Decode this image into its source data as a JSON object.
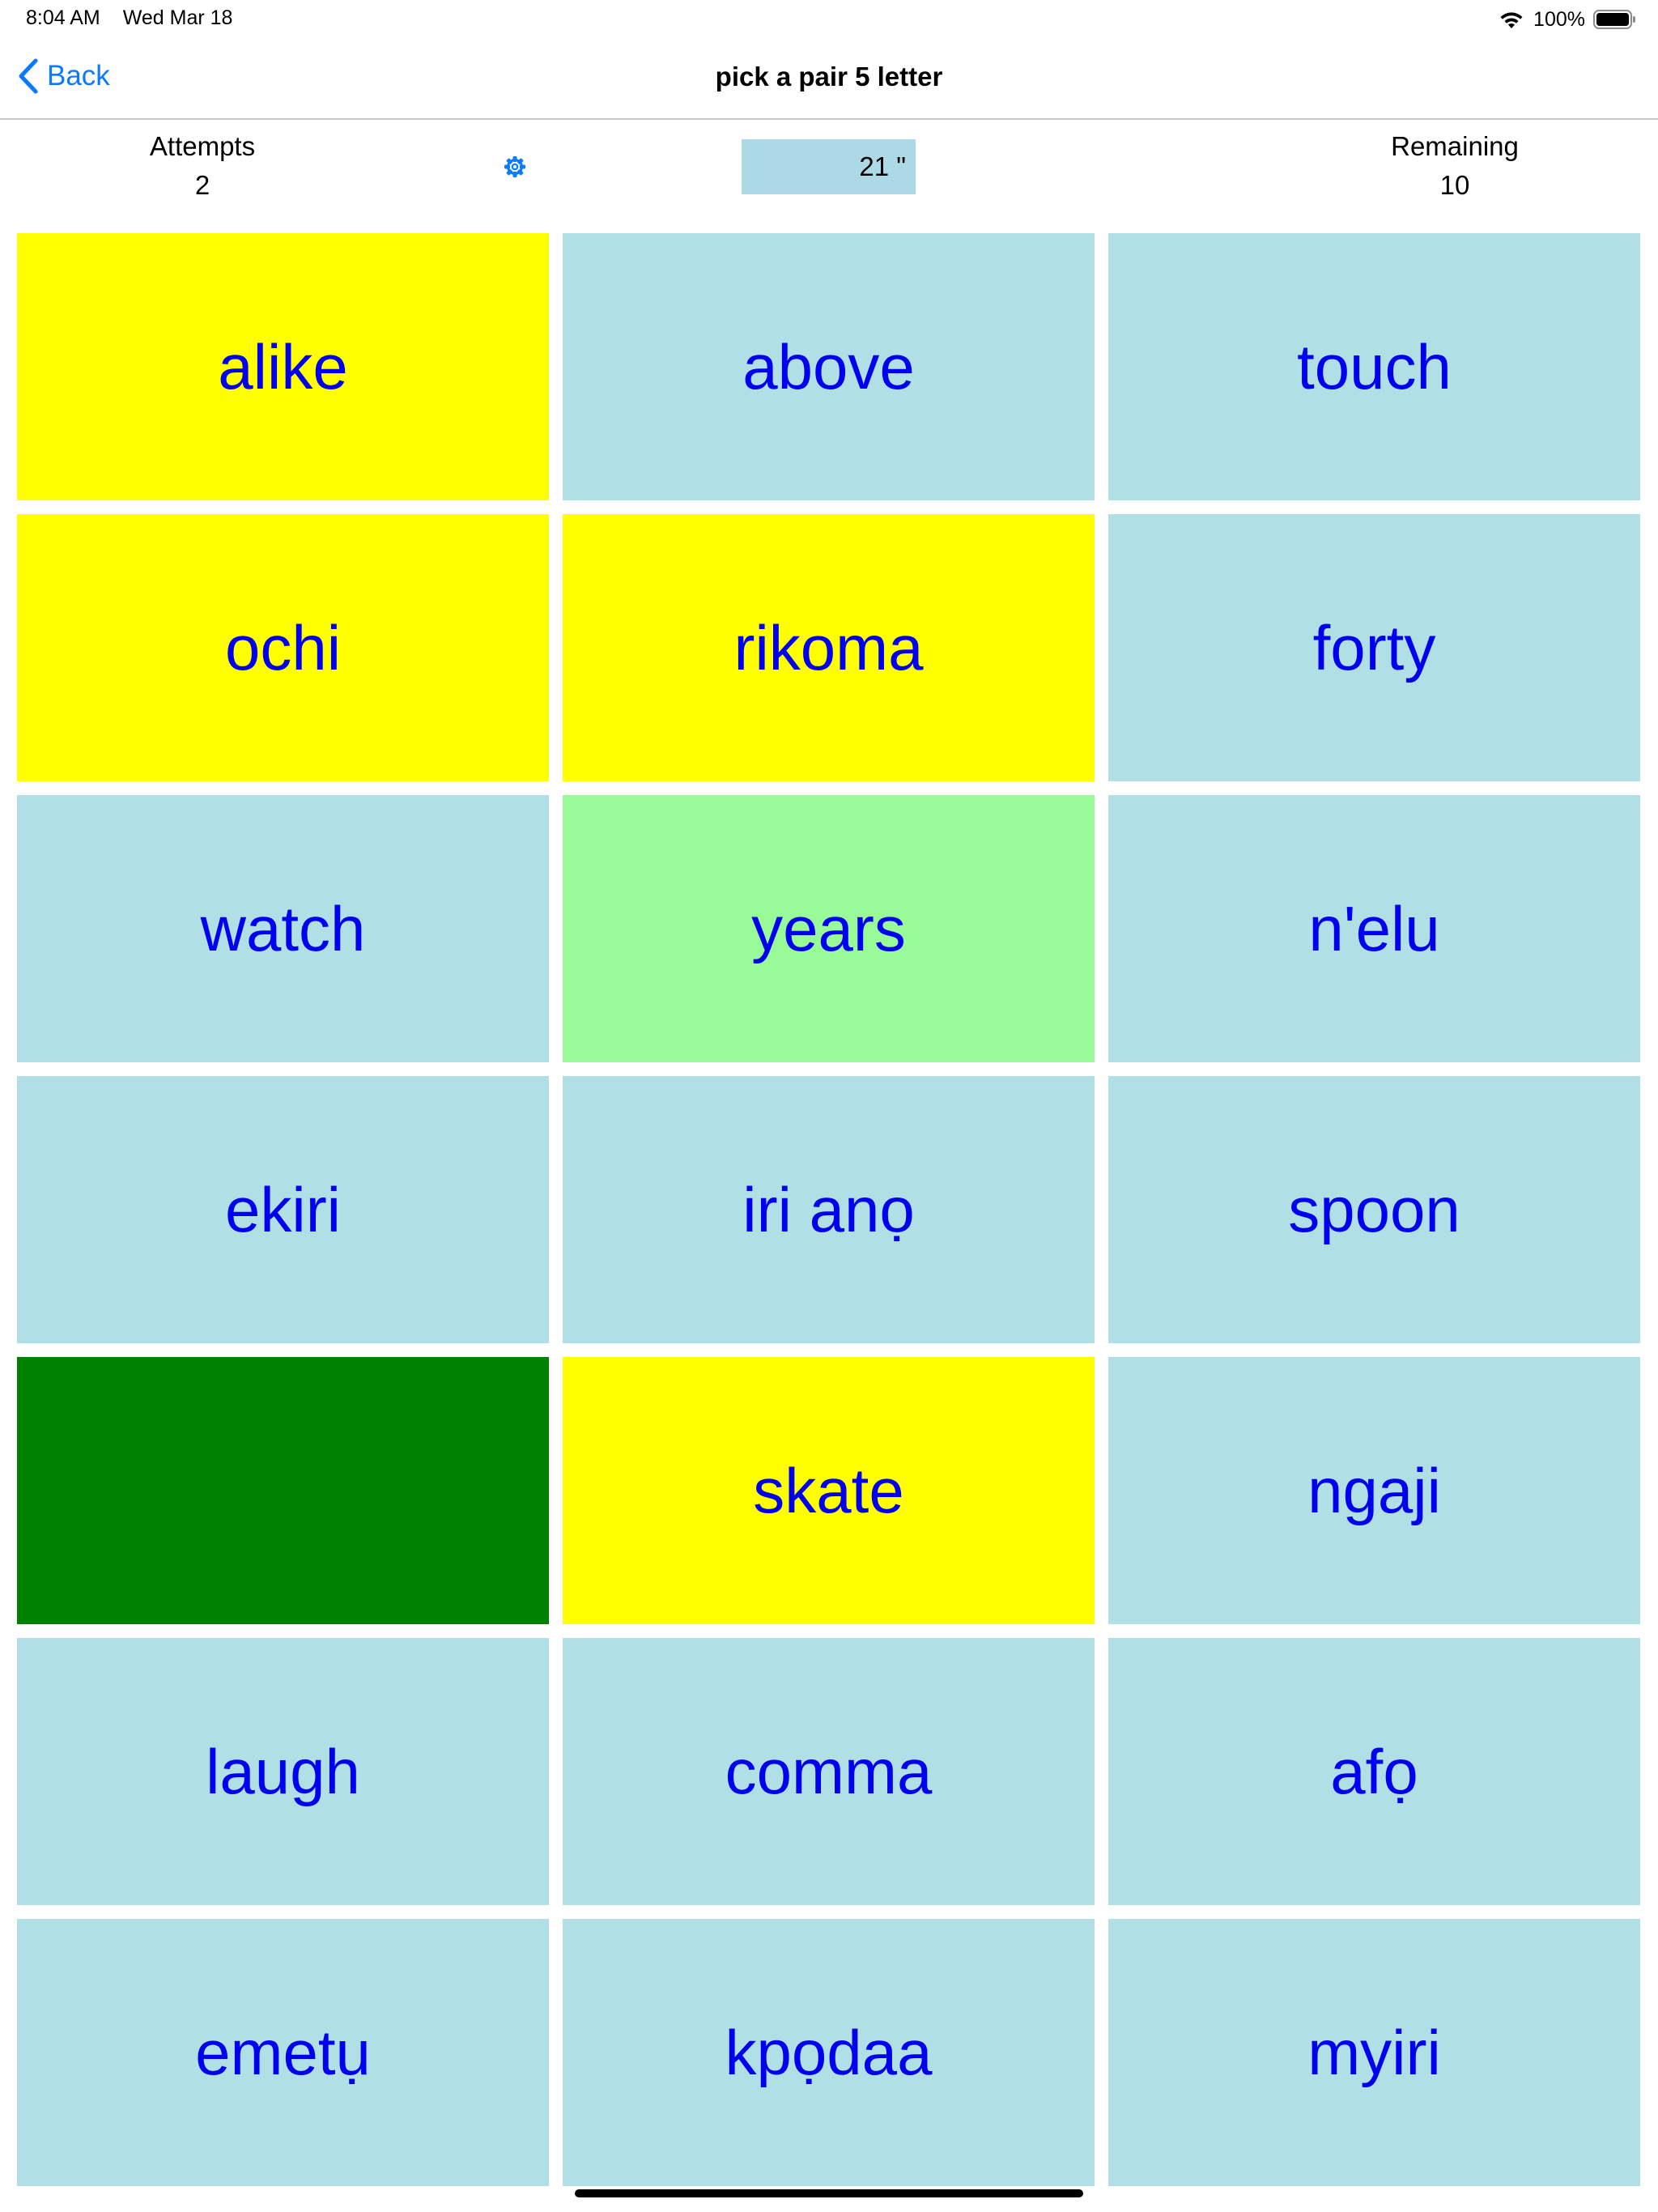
{
  "status_bar": {
    "time": "8:04 AM",
    "date": "Wed Mar 18",
    "battery": "100%",
    "icons": [
      "wifi-icon",
      "battery-icon"
    ]
  },
  "nav": {
    "back_label": "Back",
    "back_icon": "chevron-left-icon",
    "title": "pick a pair 5 letter",
    "accent_color": "#0a7aff"
  },
  "stats": {
    "attempts_label": "Attempts",
    "attempts_value": "2",
    "remaining_label": "Remaining",
    "remaining_value": "10",
    "timer": "21 \"",
    "settings_icon": "gear-icon"
  },
  "colors": {
    "unselected": "#b0dfe5",
    "selected": "#ffff00",
    "matched": "#98fb98",
    "cleared": "#008000",
    "word_text": "#0000f0"
  },
  "tiles": [
    {
      "word": "alike",
      "state": "selected"
    },
    {
      "word": "above",
      "state": "unselected"
    },
    {
      "word": "touch",
      "state": "unselected"
    },
    {
      "word": "ochi",
      "state": "selected"
    },
    {
      "word": "rikoma",
      "state": "selected"
    },
    {
      "word": "forty",
      "state": "unselected"
    },
    {
      "word": "watch",
      "state": "unselected"
    },
    {
      "word": "years",
      "state": "matched"
    },
    {
      "word": "n'elu",
      "state": "unselected"
    },
    {
      "word": "ekiri",
      "state": "unselected"
    },
    {
      "word": "iri anọ",
      "state": "unselected"
    },
    {
      "word": "spoon",
      "state": "unselected"
    },
    {
      "word": "",
      "state": "cleared"
    },
    {
      "word": "skate",
      "state": "selected"
    },
    {
      "word": "ngaji",
      "state": "unselected"
    },
    {
      "word": "laugh",
      "state": "unselected"
    },
    {
      "word": "comma",
      "state": "unselected"
    },
    {
      "word": "afọ",
      "state": "unselected"
    },
    {
      "word": "emetụ",
      "state": "unselected"
    },
    {
      "word": "kpọdaa",
      "state": "unselected"
    },
    {
      "word": "myiri",
      "state": "unselected"
    }
  ]
}
